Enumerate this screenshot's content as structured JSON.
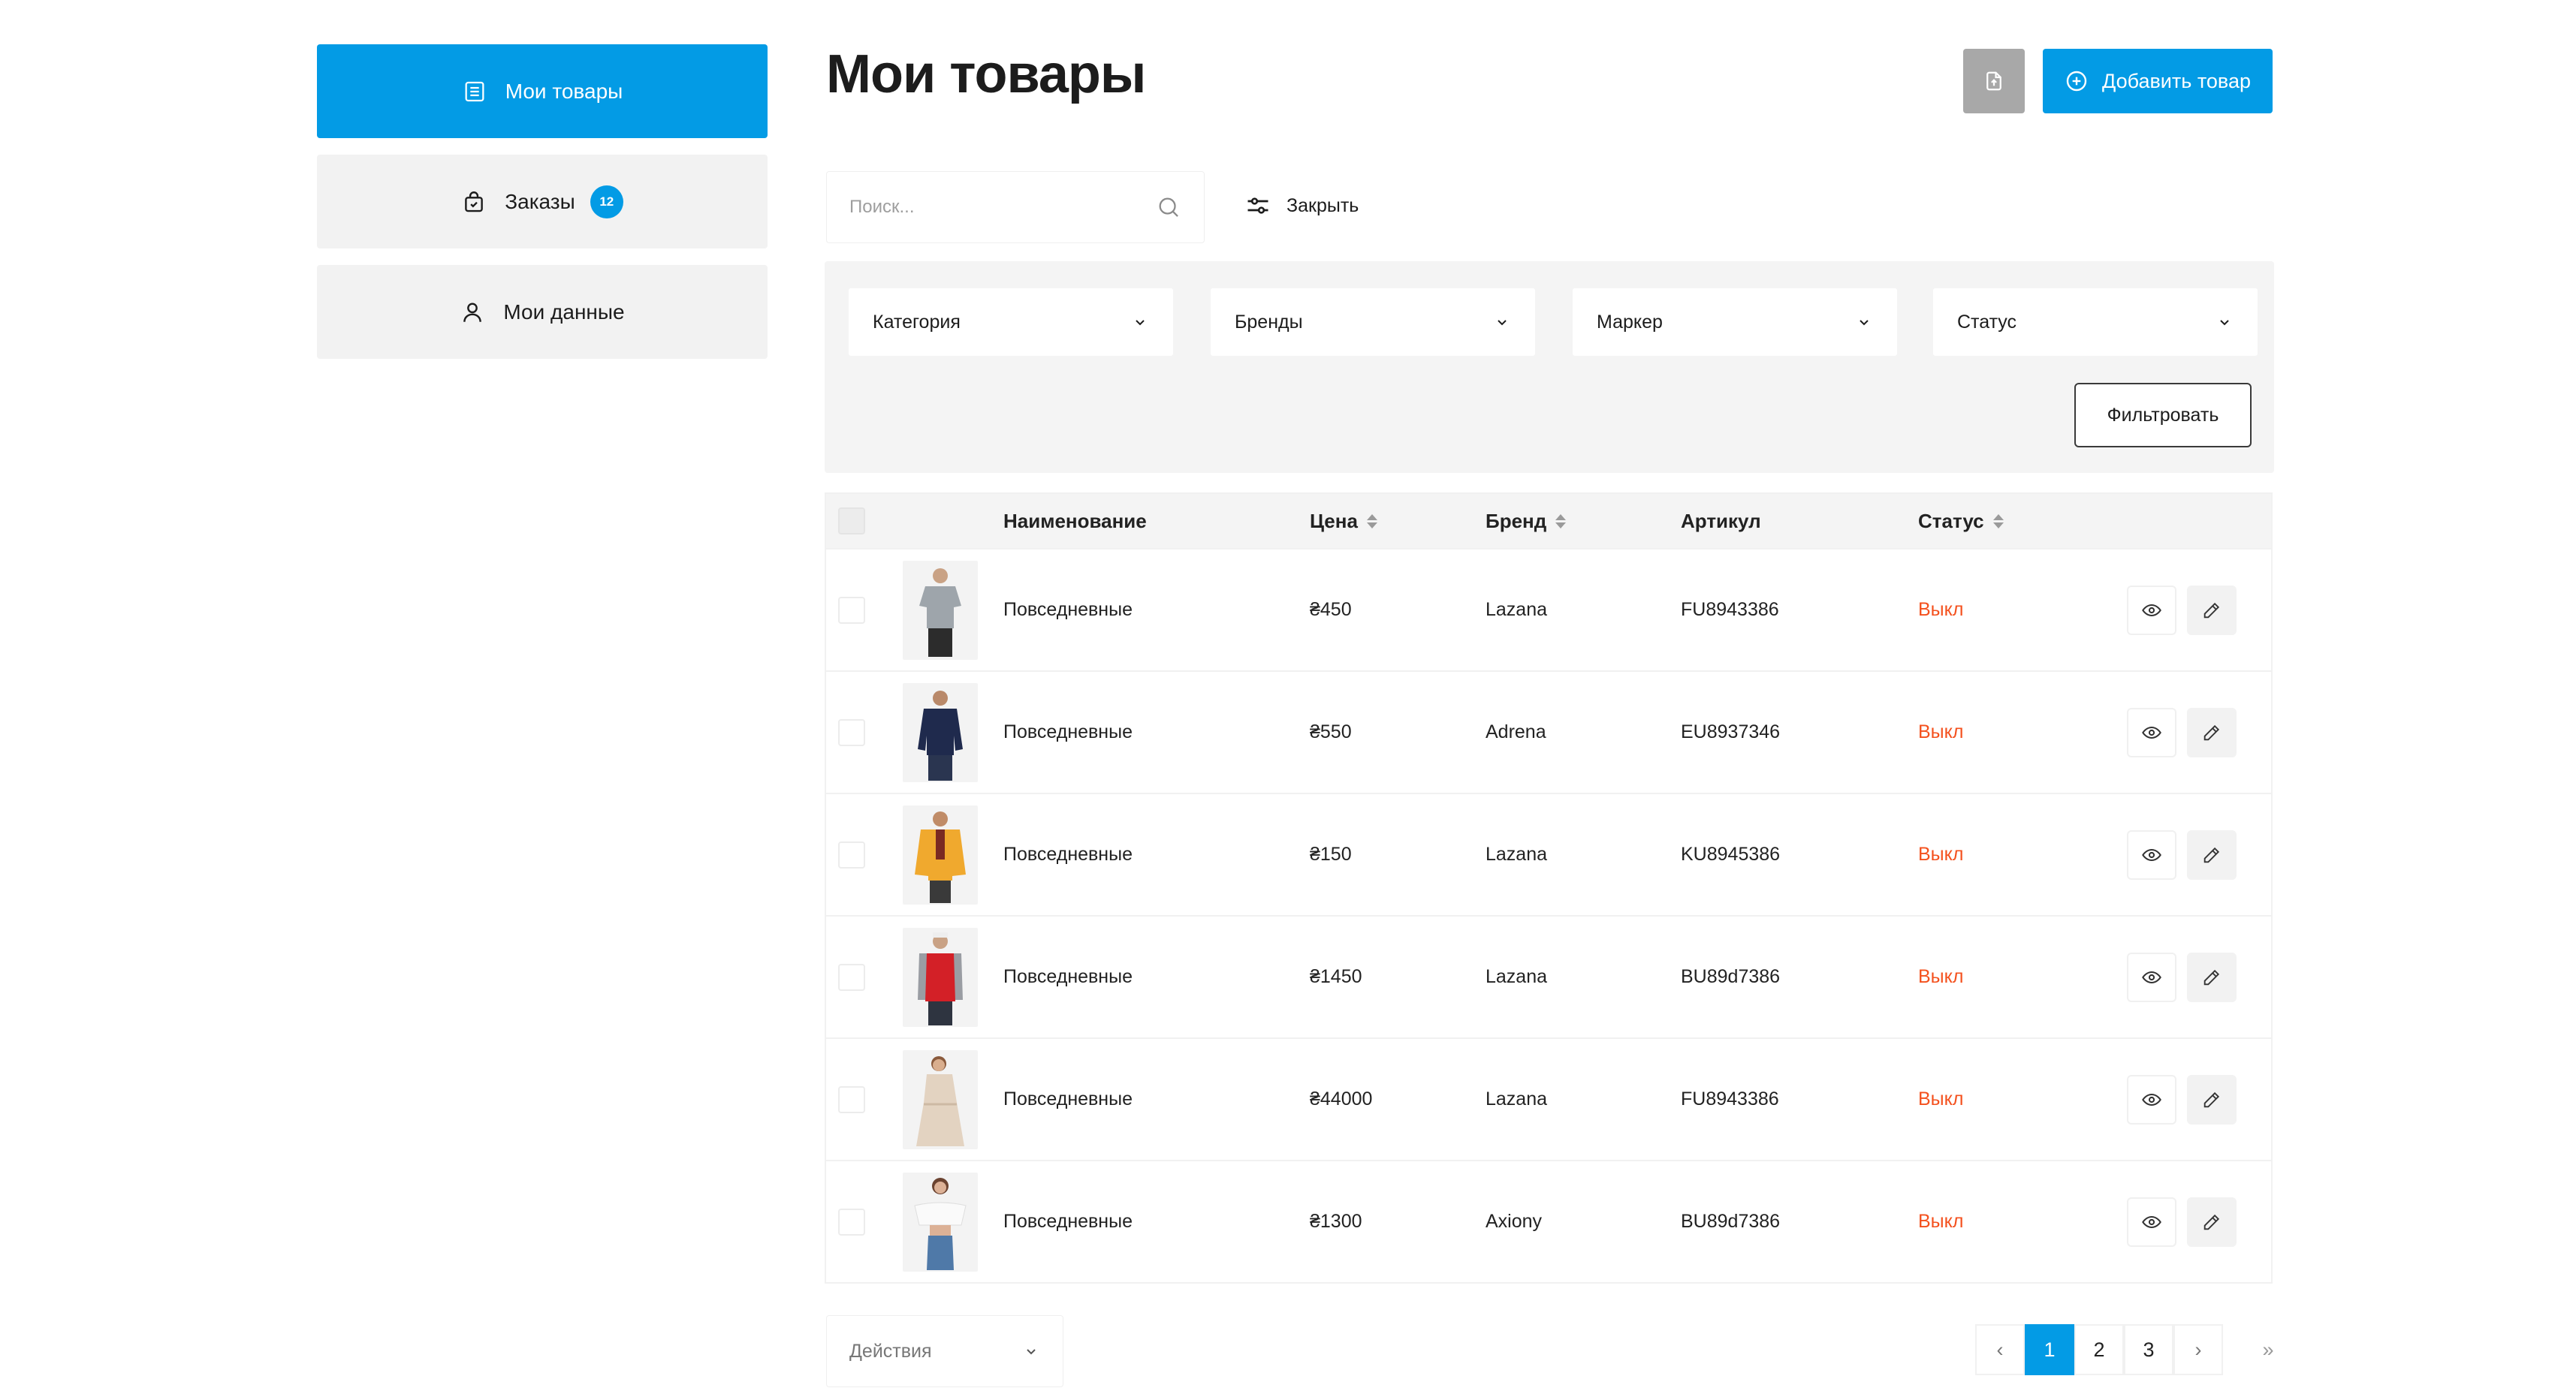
{
  "sidebar": {
    "items": [
      {
        "label": "Мои товары",
        "icon": "list-icon"
      },
      {
        "label": "Заказы",
        "icon": "shopping-bag-icon",
        "badge": "12"
      },
      {
        "label": "Мои данные",
        "icon": "user-icon"
      }
    ]
  },
  "header": {
    "title": "Мои товары",
    "add_label": "Добавить товар"
  },
  "search": {
    "placeholder": "Поиск...",
    "close_filter_label": "Закрыть"
  },
  "filters": {
    "selects": [
      "Категория",
      "Бренды",
      "Маркер",
      "Статус"
    ],
    "apply_label": "Фильтровать"
  },
  "table": {
    "columns": {
      "name": "Наименование",
      "price": "Цена",
      "brand": "Бренд",
      "sku": "Артикул",
      "status": "Статус"
    },
    "rows": [
      {
        "name": "Повседневные",
        "price": "₴450",
        "brand": "Lazana",
        "sku": "FU8943386",
        "status": "Выкл"
      },
      {
        "name": "Повседневные",
        "price": "₴550",
        "brand": "Adrena",
        "sku": "EU8937346",
        "status": "Выкл"
      },
      {
        "name": "Повседневные",
        "price": "₴150",
        "brand": "Lazana",
        "sku": "KU8945386",
        "status": "Выкл"
      },
      {
        "name": "Повседневные",
        "price": "₴1450",
        "brand": "Lazana",
        "sku": "BU89d7386",
        "status": "Выкл"
      },
      {
        "name": "Повседневные",
        "price": "₴44000",
        "brand": "Lazana",
        "sku": "FU8943386",
        "status": "Выкл"
      },
      {
        "name": "Повседневные",
        "price": "₴1300",
        "brand": "Axiony",
        "sku": "BU89d7386",
        "status": "Выкл"
      }
    ]
  },
  "bulk_actions": {
    "label": "Действия"
  },
  "pagination": {
    "prev": "‹",
    "pages": [
      "1",
      "2",
      "3"
    ],
    "current": "1",
    "next": "›",
    "last": "»"
  },
  "colors": {
    "accent": "#039be5",
    "status_off": "#f4511e"
  }
}
